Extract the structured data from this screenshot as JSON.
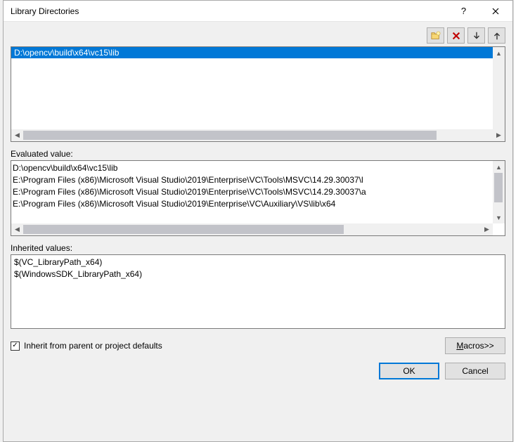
{
  "title": "Library Directories",
  "paths": {
    "selected": "D:\\opencv\\build\\x64\\vc15\\lib"
  },
  "labels": {
    "evaluated": "Evaluated value:",
    "inherited": "Inherited values:",
    "inherit_check": "Inherit from parent or project defaults",
    "macros": "Macros>>",
    "ok": "OK",
    "cancel": "Cancel"
  },
  "evaluated": [
    "D:\\opencv\\build\\x64\\vc15\\lib",
    "E:\\Program Files (x86)\\Microsoft Visual Studio\\2019\\Enterprise\\VC\\Tools\\MSVC\\14.29.30037\\l",
    "E:\\Program Files (x86)\\Microsoft Visual Studio\\2019\\Enterprise\\VC\\Tools\\MSVC\\14.29.30037\\a",
    "E:\\Program Files (x86)\\Microsoft Visual Studio\\2019\\Enterprise\\VC\\Auxiliary\\VS\\lib\\x64"
  ],
  "inherited": [
    "$(VC_LibraryPath_x64)",
    "$(WindowsSDK_LibraryPath_x64)"
  ],
  "inherit_checked": true
}
